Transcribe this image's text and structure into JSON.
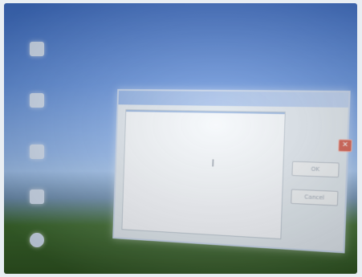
{
  "window_title": "",
  "desktop": {
    "icons": [
      {
        "name": "my-documents-icon",
        "label": ""
      },
      {
        "name": "recycle-bin-icon",
        "label": ""
      },
      {
        "name": "ie-icon",
        "label": ""
      },
      {
        "name": "network-icon",
        "label": ""
      },
      {
        "name": "globe-icon",
        "label": ""
      }
    ]
  },
  "dialog": {
    "title": "",
    "items": [
      {
        "text": "",
        "selected": true
      },
      {
        "text": "",
        "selected": false
      },
      {
        "text": "",
        "selected": false
      },
      {
        "text": "",
        "selected": false
      }
    ],
    "ok_label": "OK",
    "cancel_label": "Cancel"
  },
  "colors": {
    "sky": "#5f8fdd",
    "grass": "#3d6b2f",
    "selection": "#8fb0df",
    "close": "#d45a4a"
  }
}
